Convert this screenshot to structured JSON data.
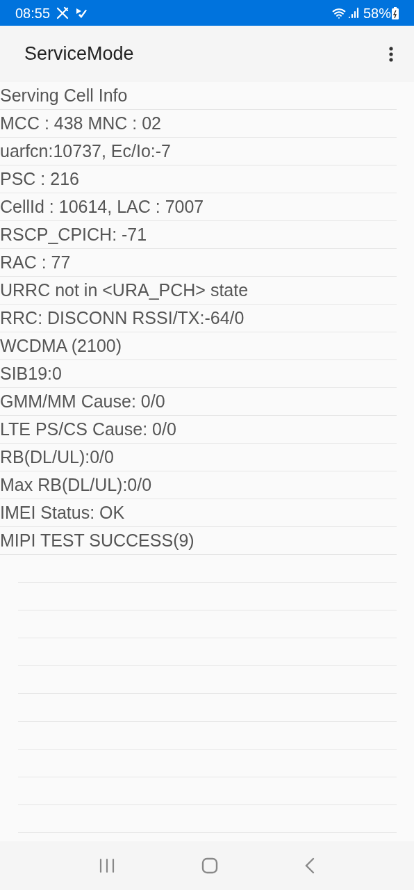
{
  "status_bar": {
    "time": "08:55",
    "battery": "58%"
  },
  "app_bar": {
    "title": "ServiceMode"
  },
  "rows": [
    "Serving Cell Info",
    "MCC : 438 MNC : 02",
    "uarfcn:10737, Ec/Io:-7",
    "PSC : 216",
    "CellId : 10614, LAC : 7007",
    "RSCP_CPICH: -71",
    "RAC : 77",
    "URRC not in <URA_PCH> state",
    "RRC: DISCONN RSSI/TX:-64/0",
    "WCDMA (2100)",
    "SIB19:0",
    "GMM/MM Cause: 0/0",
    "LTE PS/CS Cause: 0/0",
    "RB(DL/UL):0/0",
    "Max RB(DL/UL):0/0",
    "IMEI Status: OK",
    "MIPI TEST SUCCESS(9)"
  ]
}
